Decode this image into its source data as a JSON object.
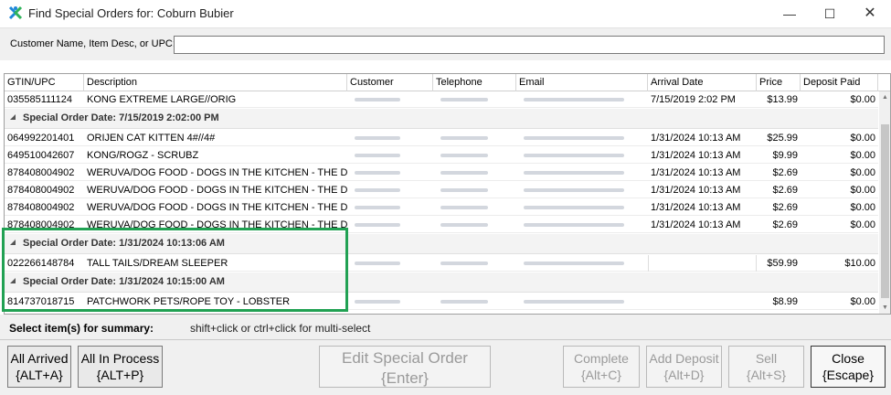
{
  "window": {
    "title": "Find Special Orders for: Coburn Bubier",
    "min": "—",
    "max": "☐",
    "close": "✕"
  },
  "search": {
    "label": "Customer Name, Item Desc, or UPC:",
    "value": ""
  },
  "columns": [
    "GTIN/UPC",
    "Description",
    "Customer",
    "Telephone",
    "Email",
    "Arrival Date",
    "Price",
    "Deposit Paid"
  ],
  "rows_top": [
    {
      "upc": "035585111124",
      "desc": "KONG EXTREME LARGE//ORIG",
      "arrival": "7/15/2019 2:02 PM",
      "price": "$13.99",
      "deposit": "$0.00"
    }
  ],
  "group1": {
    "label": "Special Order Date: 7/15/2019 2:02:00 PM",
    "rows": [
      {
        "upc": "064992201401",
        "desc": "ORIJEN CAT KITTEN 4#//4#",
        "arrival": "1/31/2024 10:13 AM",
        "price": "$25.99",
        "deposit": "$0.00"
      },
      {
        "upc": "649510042607",
        "desc": "KONG/ROGZ - SCRUBZ",
        "arrival": "1/31/2024 10:13 AM",
        "price": "$9.99",
        "deposit": "$0.00"
      },
      {
        "upc": "878408004902",
        "desc": "WERUVA/DOG FOOD - DOGS IN THE KITCHEN - THE D...",
        "arrival": "1/31/2024 10:13 AM",
        "price": "$2.69",
        "deposit": "$0.00"
      },
      {
        "upc": "878408004902",
        "desc": "WERUVA/DOG FOOD - DOGS IN THE KITCHEN - THE D...",
        "arrival": "1/31/2024 10:13 AM",
        "price": "$2.69",
        "deposit": "$0.00"
      },
      {
        "upc": "878408004902",
        "desc": "WERUVA/DOG FOOD - DOGS IN THE KITCHEN - THE D...",
        "arrival": "1/31/2024 10:13 AM",
        "price": "$2.69",
        "deposit": "$0.00"
      },
      {
        "upc": "878408004902",
        "desc": "WERUVA/DOG FOOD - DOGS IN THE KITCHEN - THE D...",
        "arrival": "1/31/2024 10:13 AM",
        "price": "$2.69",
        "deposit": "$0.00"
      }
    ]
  },
  "group2": {
    "label": "Special Order Date: 1/31/2024 10:13:06 AM",
    "rows": [
      {
        "upc": "022266148784",
        "desc": "TALL TAILS/DREAM SLEEPER",
        "arrival": "",
        "price": "$59.99",
        "deposit": "$10.00"
      }
    ]
  },
  "group3": {
    "label": "Special Order Date: 1/31/2024 10:15:00 AM",
    "rows": [
      {
        "upc": "814737018715",
        "desc": "PATCHWORK PETS/ROPE TOY - LOBSTER",
        "arrival": "",
        "price": "$8.99",
        "deposit": "$0.00"
      }
    ]
  },
  "summary": {
    "label": "Select item(s) for summary:",
    "hint": "shift+click or ctrl+click for multi-select"
  },
  "buttons": {
    "all_arrived": [
      "All Arrived",
      "{ALT+A}"
    ],
    "all_in_process": [
      "All In Process",
      "{ALT+P}"
    ],
    "edit": [
      "Edit Special Order",
      "{Enter}"
    ],
    "complete": [
      "Complete",
      "{Alt+C}"
    ],
    "add_deposit": [
      "Add Deposit",
      "{Alt+D}"
    ],
    "sell": [
      "Sell",
      "{Alt+S}"
    ],
    "close": [
      "Close",
      "{Escape}"
    ]
  },
  "colors": {
    "highlight": "#21a153",
    "icon_blue": "#1e88d8",
    "icon_green": "#2fb35b"
  }
}
